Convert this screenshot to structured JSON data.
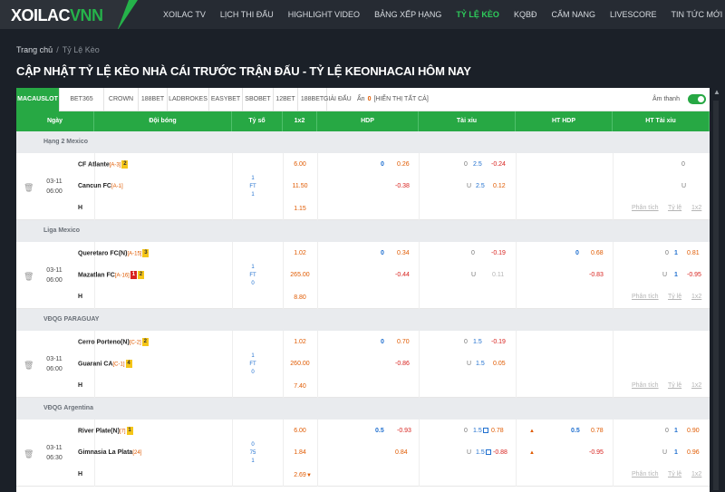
{
  "logo": {
    "part1": "XOILAC",
    "part2": "VNN"
  },
  "nav": [
    "XOILAC TV",
    "LỊCH THI ĐẤU",
    "HIGHLIGHT VIDEO",
    "BẢNG XẾP HẠNG",
    "TỶ LỆ KÈO",
    "KQBĐ",
    "CẨM NANG",
    "LIVESCORE",
    "TIN TỨC MỚI"
  ],
  "nav_active_index": 4,
  "breadcrumb": {
    "home": "Trang chủ",
    "sep": "/",
    "current": "Tỷ Lệ Kèo"
  },
  "page_title": "CẬP NHẬT TỶ LỆ KÈO NHÀ CÁI TRƯỚC TRẬN ĐẤU - TỶ LỆ KEONHACAI HÔM NAY",
  "bookmakers": [
    "MACAUSLOT",
    "BET365",
    "CROWN",
    "188BET",
    "LADBROKES",
    "EASYBET",
    "SBOBET",
    "12BET",
    "188BET",
    "GIẢI ĐẤU"
  ],
  "hidden": {
    "label": "Ẩn",
    "count": "0",
    "show_all": "[HIỂN THỊ TẤT CẢ]"
  },
  "sound": {
    "label": "Âm thanh",
    "on": true
  },
  "columns": [
    "Ngày",
    "Đội bóng",
    "Tỷ số",
    "1x2",
    "HDP",
    "Tài xỉu",
    "HT HDP",
    "HT Tài xỉu"
  ],
  "links": {
    "analysis": "Phân tích",
    "odds": "Tỷ lệ",
    "x12": "1x2"
  },
  "draw_label": "H",
  "matches": [
    {
      "league": "Hạng 2 Mexico",
      "date": "03-11",
      "time": "06:00",
      "home": "CF Atlante",
      "home_rank": "[A-3]",
      "home_badges": [
        "2"
      ],
      "away": "Cancun FC",
      "away_rank": "[A-1]",
      "away_badges": [],
      "score": [
        "1",
        "FT",
        "1"
      ],
      "x12": [
        "6.00",
        "11.50",
        "1.15"
      ],
      "hdp_line": "0",
      "hdp_home": "0.26",
      "hdp_away": "-0.38",
      "ou_top": "0",
      "ou_line": "2.5",
      "ou_over": "-0.24",
      "ou_u": "U",
      "ou_under": "0.12",
      "ht_hdp": "",
      "ht_ou_top": "0",
      "ht_ou_u": "U"
    },
    {
      "league": "Liga Mexico",
      "date": "03-11",
      "time": "06:00",
      "home": "Queretaro FC(N)",
      "home_rank": "[A-15]",
      "home_badges": [
        "3"
      ],
      "away": "Mazatlan FC",
      "away_rank": "[A-16]",
      "away_badges": [
        "1",
        "2"
      ],
      "score": [
        "1",
        "FT",
        "0"
      ],
      "x12": [
        "1.02",
        "265.00",
        "8.80"
      ],
      "hdp_line": "0",
      "hdp_home": "0.34",
      "hdp_away": "-0.44",
      "ou_top": "0",
      "ou_line": "",
      "ou_over": "-0.19",
      "ou_u": "U",
      "ou_under": "0.11",
      "ht_hdp": "0",
      "ht_hdp_home": "0.68",
      "ht_hdp_away": "-0.83",
      "ht_ou_top": "0",
      "ht_ou_line": "1",
      "ht_ou_top_val": "0.81",
      "ht_ou_u": "U",
      "ht_ou_line2": "1",
      "ht_ou_under": "-0.95"
    },
    {
      "league": "VĐQG PARAGUAY",
      "date": "03-11",
      "time": "06:00",
      "home": "Cerro Porteno(N)",
      "home_rank": "[C-2]",
      "home_badges": [
        "2"
      ],
      "away": "Guarani CA",
      "away_rank": "[C-1]",
      "away_badges": [
        "4"
      ],
      "score": [
        "1",
        "FT",
        "0"
      ],
      "x12": [
        "1.02",
        "260.00",
        "7.40"
      ],
      "hdp_line": "0",
      "hdp_home": "0.70",
      "hdp_away": "-0.86",
      "ou_top": "0",
      "ou_line": "1.5",
      "ou_over": "-0.19",
      "ou_u": "U",
      "ou_line2": "1.5",
      "ou_under": "0.05",
      "ht_hdp": "",
      "ht_ou_top": "",
      "ht_ou_u": ""
    },
    {
      "league": "VĐQG Argentina",
      "date": "03-11",
      "time": "06:30",
      "home": "River Plate(N)",
      "home_rank": "[7]",
      "home_badges": [
        "1"
      ],
      "away": "Gimnasia La Plata",
      "away_rank": "[24]",
      "away_badges": [],
      "score": [
        "0",
        "75",
        "1"
      ],
      "x12": [
        "6.00",
        "1.84",
        "2.69"
      ],
      "hdp_line": "0.5",
      "hdp_home": "-0.93",
      "hdp_away": "0.84",
      "ou_top": "0",
      "ou_line": "1.5",
      "ou_over": "0.78",
      "ou_u": "U",
      "ou_line2": "1.5",
      "ou_under": "-0.88",
      "ht_hdp": "0.5",
      "ht_hdp_home": "0.78",
      "ht_hdp_away": "-0.95",
      "ht_ou_top": "0",
      "ht_ou_line": "1",
      "ht_ou_top_val": "0.90",
      "ht_ou_u": "U",
      "ht_ou_line2": "1",
      "ht_ou_under": "0.96"
    }
  ]
}
